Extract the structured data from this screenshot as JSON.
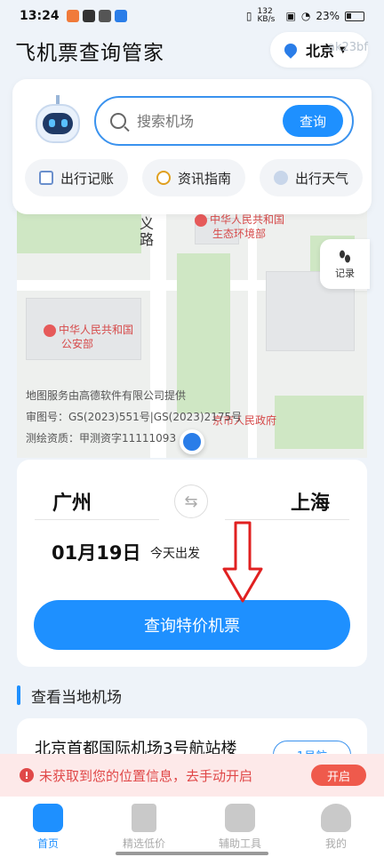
{
  "status_bar": {
    "time": "13:24",
    "net_speed": "132 KB/s",
    "battery": "23%"
  },
  "header": {
    "title": "飞机票查询管家",
    "city": "北京",
    "watermark": "ak23bf"
  },
  "search": {
    "placeholder": "搜索机场",
    "button": "查询"
  },
  "chips": [
    {
      "label": "出行记账",
      "icon": "notebook-icon"
    },
    {
      "label": "资讯指南",
      "icon": "compass-icon"
    },
    {
      "label": "出行天气",
      "icon": "cloud-icon"
    }
  ],
  "map": {
    "road": "义路",
    "pois": [
      "中华人民共和国",
      "生态环境部",
      "中华人民共和国",
      "公安部"
    ],
    "gov": "京市人民政府",
    "credits": [
      "地图服务由高德软件有限公司提供",
      "审图号：GS(2023)551号|GS(2023)2175号",
      "测绘资质：甲测资字11111093"
    ],
    "record_button": "记录"
  },
  "route": {
    "from": "广州",
    "to": "上海",
    "date": "01月19日",
    "date_note": "今天出发",
    "cta": "查询特价机票"
  },
  "local_airports": {
    "title": "查看当地机场",
    "airport": "北京首都国际机场3号航站楼",
    "badge": "1号航"
  },
  "location_banner": {
    "text": "未获取到您的位置信息，去手动开启",
    "button": "开启"
  },
  "bottom_nav": [
    {
      "label": "首页",
      "icon": "home-icon",
      "active": true
    },
    {
      "label": "精选低价",
      "icon": "bookmark-icon",
      "active": false
    },
    {
      "label": "辅助工具",
      "icon": "tools-icon",
      "active": false
    },
    {
      "label": "我的",
      "icon": "person-icon",
      "active": false
    }
  ],
  "colors": {
    "accent": "#1e90ff",
    "alert": "#e04848",
    "annotation_arrow": "#e02020"
  }
}
